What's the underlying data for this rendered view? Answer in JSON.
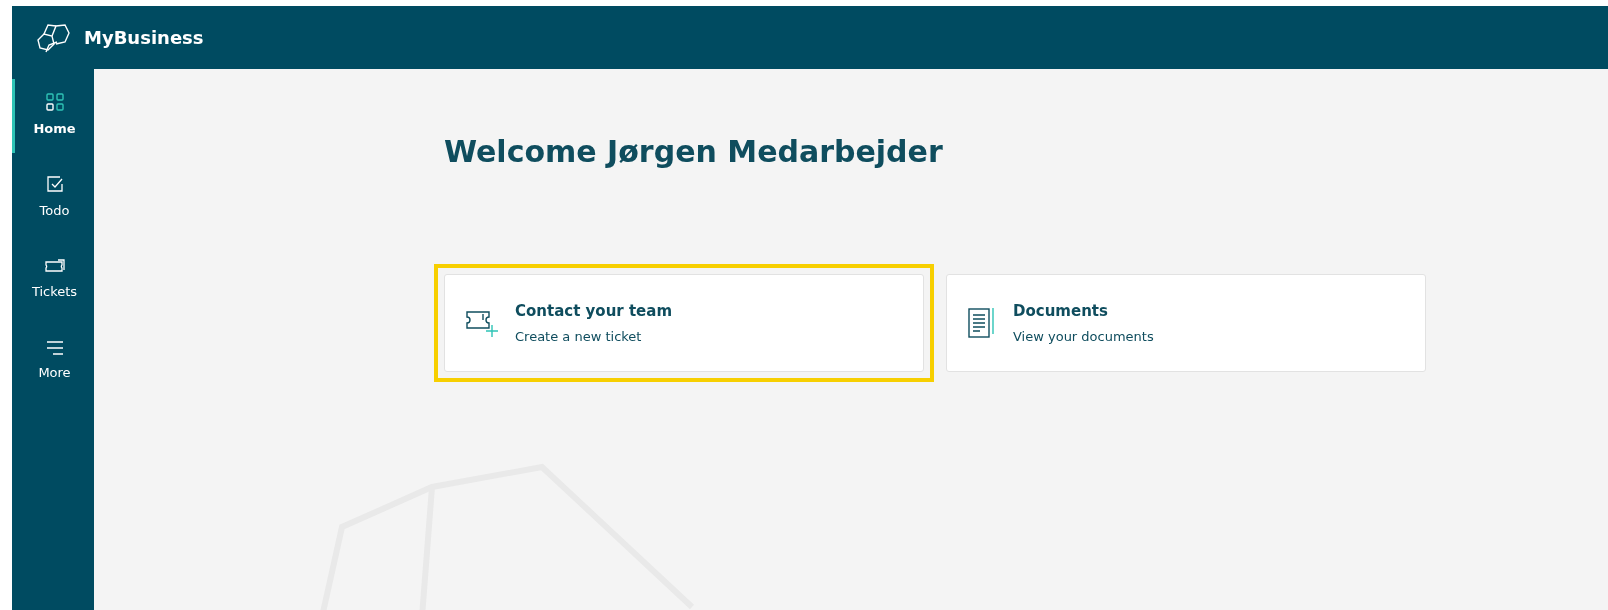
{
  "header": {
    "brand": "MyBusiness"
  },
  "sidebar": {
    "items": [
      {
        "label": "Home",
        "kind": "grid",
        "selected": true
      },
      {
        "label": "Todo",
        "kind": "check",
        "selected": false
      },
      {
        "label": "Tickets",
        "kind": "ticket",
        "selected": false
      },
      {
        "label": "More",
        "kind": "menu",
        "selected": false
      }
    ]
  },
  "main": {
    "title": "Welcome Jørgen Medarbejder",
    "cards": [
      {
        "title": "Contact your team",
        "subtitle": "Create a new ticket",
        "kind": "ticket",
        "highlighted": true
      },
      {
        "title": "Documents",
        "subtitle": "View your documents",
        "kind": "document",
        "highlighted": false
      }
    ]
  }
}
